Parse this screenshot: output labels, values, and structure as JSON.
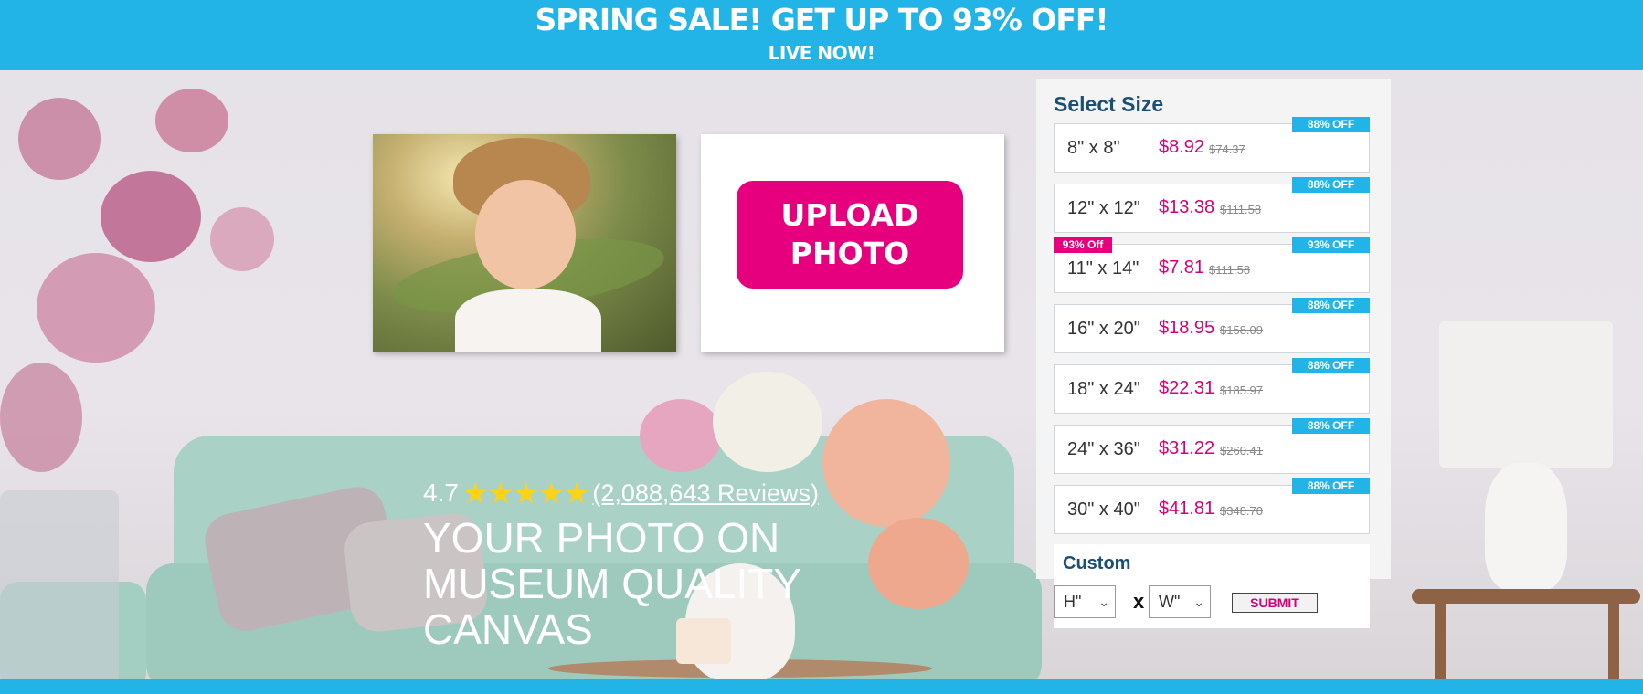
{
  "banner": {
    "title": "SPRING SALE! GET UP TO 93% OFF!",
    "subtitle": "LIVE NOW!"
  },
  "upload": {
    "label": "UPLOAD\nPHOTO"
  },
  "rating": {
    "score": "4.7",
    "stars": "★★★★★",
    "star_value": 4.7,
    "reviews": "(2,088,643 Reviews)"
  },
  "headline": "YOUR PHOTO ON MUSEUM QUALITY CANVAS",
  "size_panel": {
    "title": "Select Size",
    "sizes": [
      {
        "label": "8\" x 8\"",
        "price": "$8.92",
        "old_price": "$74.37",
        "badge": "88% OFF",
        "left_badge": ""
      },
      {
        "label": "12\" x 12\"",
        "price": "$13.38",
        "old_price": "$111.58",
        "badge": "88% OFF",
        "left_badge": ""
      },
      {
        "label": "11\" x 14\"",
        "price": "$7.81",
        "old_price": "$111.58",
        "badge": "93% OFF",
        "left_badge": "93% Off"
      },
      {
        "label": "16\" x 20\"",
        "price": "$18.95",
        "old_price": "$158.09",
        "badge": "88% OFF",
        "left_badge": ""
      },
      {
        "label": "18\" x 24\"",
        "price": "$22.31",
        "old_price": "$185.97",
        "badge": "88% OFF",
        "left_badge": ""
      },
      {
        "label": "24\" x 36\"",
        "price": "$31.22",
        "old_price": "$260.41",
        "badge": "88% OFF",
        "left_badge": ""
      },
      {
        "label": "30\" x 40\"",
        "price": "$41.81",
        "old_price": "$348.70",
        "badge": "88% OFF",
        "left_badge": ""
      }
    ]
  },
  "custom": {
    "title": "Custom",
    "height_value": "H\"",
    "width_value": "W\"",
    "times": "x",
    "submit": "SUBMIT"
  },
  "colors": {
    "brand_blue": "#22b4e6",
    "brand_pink": "#e6007e",
    "price_pink": "#d4007a",
    "navy": "#1b4f73"
  },
  "icons": [
    "star-icon",
    "chevron-down-icon"
  ]
}
